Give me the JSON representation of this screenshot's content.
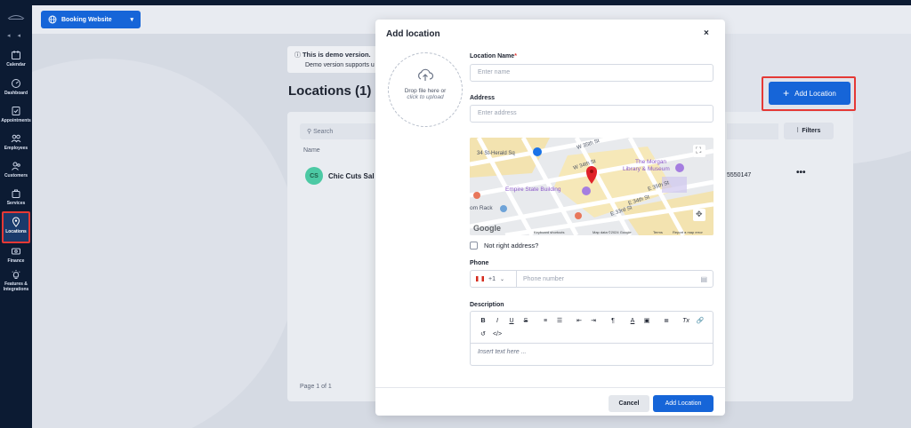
{
  "sidebar": {
    "items": [
      {
        "label": "Calendar",
        "icon": "calendar-icon"
      },
      {
        "label": "Dashboard",
        "icon": "dashboard-icon"
      },
      {
        "label": "Appointments",
        "icon": "checklist-icon"
      },
      {
        "label": "Employees",
        "icon": "employees-icon"
      },
      {
        "label": "Customers",
        "icon": "customers-icon"
      },
      {
        "label": "Services",
        "icon": "services-icon"
      },
      {
        "label": "Locations",
        "icon": "location-pin-icon",
        "active": true
      },
      {
        "label": "Finance",
        "icon": "finance-icon"
      },
      {
        "label": "Features & Integrations",
        "icon": "features-icon"
      }
    ],
    "collapse": "◂ ◂"
  },
  "header": {
    "booking_button": "Booking Website"
  },
  "demo": {
    "title": "This is demo version.",
    "text": "Demo version supports u"
  },
  "page": {
    "title": "Locations (1)",
    "add_button": "Add Location",
    "search_placeholder": "Search",
    "filters": "Filters",
    "column_name": "Name",
    "row": {
      "initials": "CS",
      "name": "Chic Cuts Sal",
      "phone": "5550147",
      "more": "•••"
    },
    "pagination": "Page 1 of 1"
  },
  "modal": {
    "title": "Add location",
    "close": "×",
    "upload_line1": "Drop file here or",
    "upload_line2": "click to upload",
    "name_label": "Location Name",
    "name_required": "*",
    "name_placeholder": "Enter name",
    "address_label": "Address",
    "address_placeholder": "Enter address",
    "map": {
      "labels": [
        "W 35th St",
        "34 St-Herald Sq",
        "W 34th St",
        "The Morgan",
        "Library & Museum",
        "E 35th St",
        "E 34th St",
        "Empire State Building",
        "E 33rd St",
        "om Rack",
        "Google",
        "Keyboard shortcuts",
        "Map data ©2024 Google",
        "Terms",
        "Report a map error"
      ]
    },
    "not_right_address": "Not right address?",
    "phone_label": "Phone",
    "phone_code": "+1",
    "phone_placeholder": "Phone number",
    "description_label": "Description",
    "toolbar": [
      "B",
      "I",
      "U",
      "S",
      "≡",
      "☰",
      "⇤",
      "⇥",
      "¶",
      "A",
      "▣",
      "≣",
      "Tx",
      "🔗",
      "↺",
      "</>"
    ],
    "editor_placeholder": "Insert text here ...",
    "cancel": "Cancel",
    "submit": "Add Location"
  }
}
